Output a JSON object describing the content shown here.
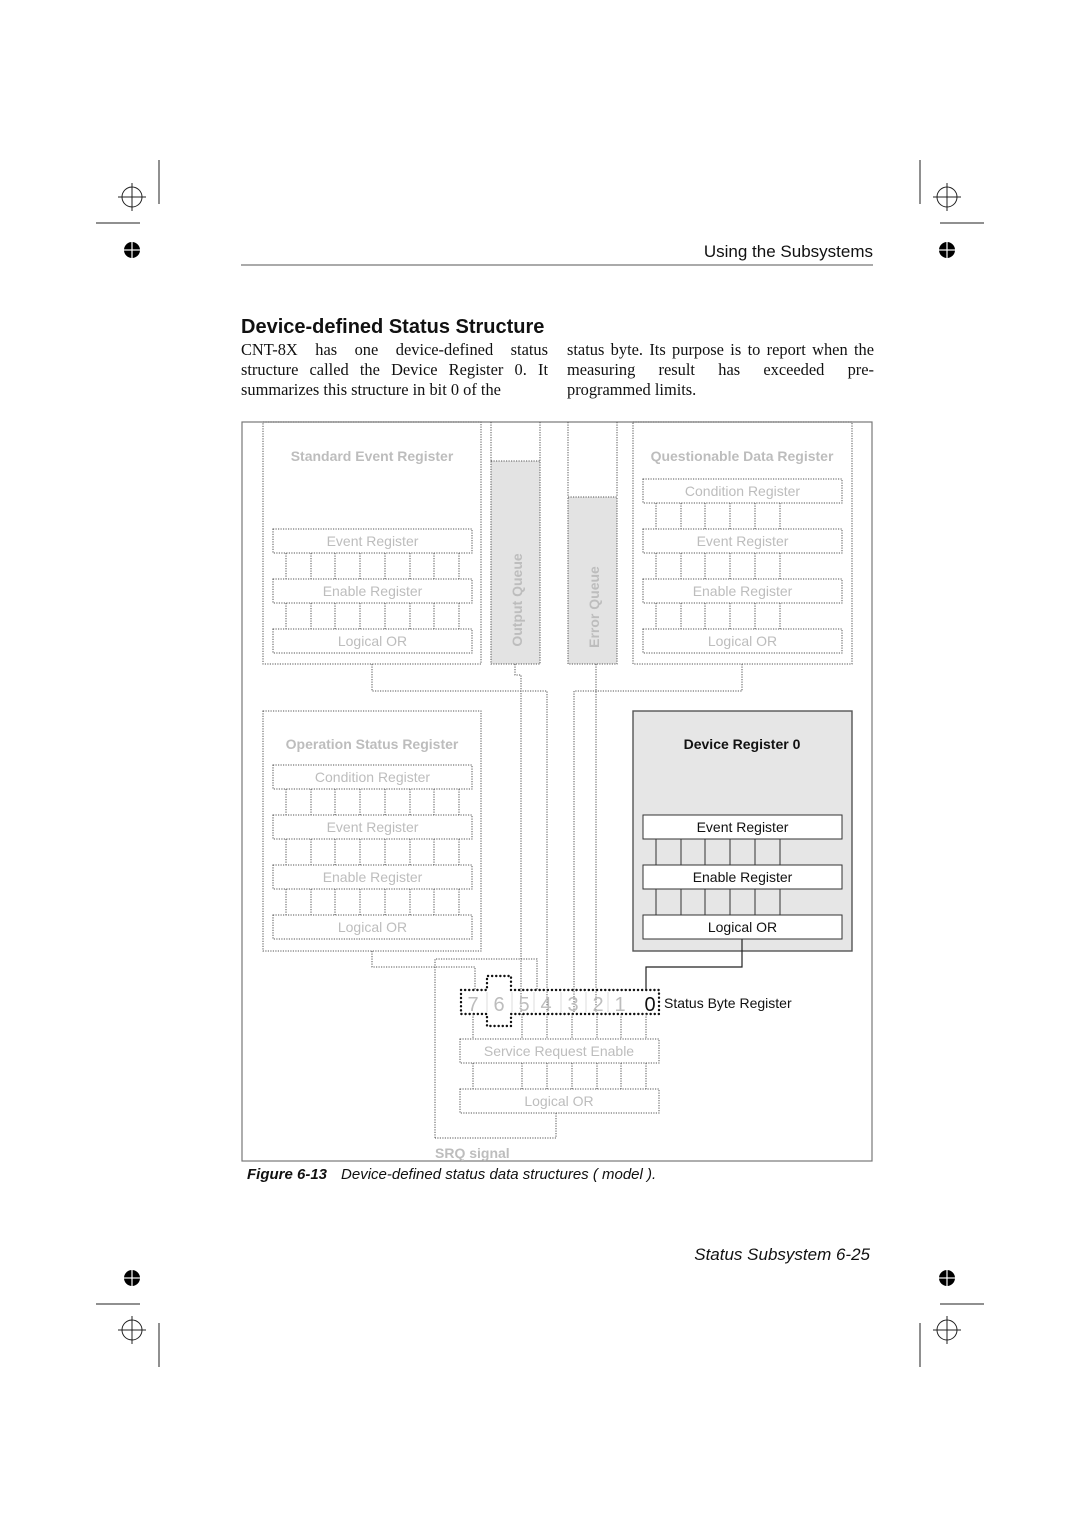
{
  "header": {
    "section": "Using the Subsystems"
  },
  "title": "Device-defined Status Structure",
  "body": {
    "column1": "CNT-8X has one device-defined status structure called the Device Register 0. It summarizes this structure in bit 0 of the",
    "column2": "status byte. Its purpose is to report when the measuring result has exceeded pre-programmed limits."
  },
  "diagram": {
    "standard_event": {
      "title": "Standard Event Register",
      "rows": [
        "Event Register",
        "Enable Register",
        "Logical OR"
      ]
    },
    "output_queue": "Output Queue",
    "error_queue": "Error Queue",
    "questionable": {
      "title": "Questionable Data Register",
      "rows": [
        "Condition Register",
        "Event Register",
        "Enable Register",
        "Logical OR"
      ]
    },
    "operation": {
      "title": "Operation Status Register",
      "rows": [
        "Condition Register",
        "Event Register",
        "Enable Register",
        "Logical OR"
      ]
    },
    "device_register": {
      "title": "Device Register 0",
      "rows": [
        "Event Register",
        "Enable Register",
        "Logical OR"
      ]
    },
    "status_byte": {
      "label": "Status Byte Register",
      "bits": [
        "7",
        "6",
        "5",
        "4",
        "3",
        "2",
        "1",
        "0"
      ]
    },
    "service_request_enable": "Service Request Enable",
    "srq_logical_or": "Logical OR",
    "srq_signal": "SRQ signal",
    "colors": {
      "faded_text": "#bdbdbd",
      "dotted_line": "#555555",
      "queue_fill": "#e3e3e3",
      "device_fill": "#e6e6e6"
    }
  },
  "caption": {
    "label": "Figure 6-13",
    "text": "Device-defined status data structures ( model )."
  },
  "footer": {
    "page": "Status Subsystem 6-25"
  }
}
